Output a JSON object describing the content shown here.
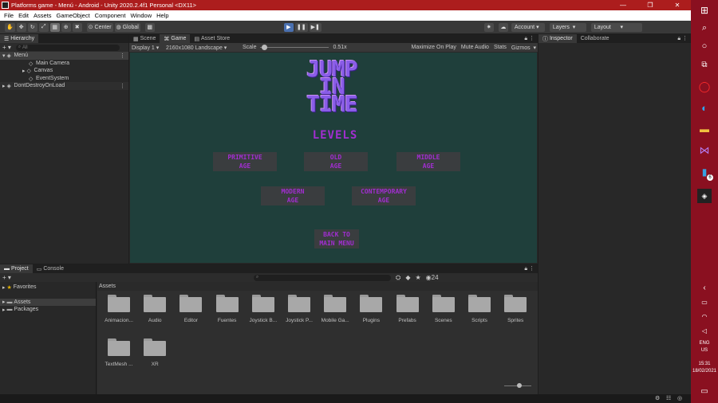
{
  "titlebar": {
    "title": "Platforms game - Menú - Android - Unity 2020.2.4f1 Personal <DX11>",
    "minimize": "—",
    "maximize": "❐",
    "close": "✕"
  },
  "menu": [
    "File",
    "Edit",
    "Assets",
    "GameObject",
    "Component",
    "Window",
    "Help"
  ],
  "toolbar": {
    "pivot": "Center",
    "space": "Global",
    "account": "Account",
    "layers": "Layers",
    "layout": "Layout"
  },
  "hierarchy": {
    "tab": "Hierarchy",
    "search_placeholder": "All",
    "scene": "Menú",
    "items": [
      "Main Camera",
      "Canvas",
      "EventSystem"
    ],
    "dontdestroy": "DontDestroyOnLoad"
  },
  "tabs": {
    "scene": "Scene",
    "game": "Game",
    "assetstore": "Asset Store",
    "inspector": "Inspector",
    "collaborate": "Collaborate",
    "project": "Project",
    "console": "Console"
  },
  "game": {
    "display": "Display 1",
    "resolution": "2160x1080 Landscape",
    "scale_label": "Scale",
    "scale_value": "0.51x",
    "maximize": "Maximize On Play",
    "mute": "Mute Audio",
    "stats": "Stats",
    "gizmos": "Gizmos",
    "logo": [
      "JUMP",
      "IN",
      "TIME"
    ],
    "levels_title": "LEVELS",
    "buttons": [
      [
        "PRIMITIVE",
        "AGE"
      ],
      [
        "OLD",
        "AGE"
      ],
      [
        "MIDDLE",
        "AGE"
      ],
      [
        "MODERN",
        "AGE"
      ],
      [
        "CONTEMPORARY",
        "AGE"
      ],
      [
        "BACK TO",
        "MAIN MENU"
      ]
    ]
  },
  "project": {
    "favorites": "Favorites",
    "assets": "Assets",
    "packages": "Packages",
    "breadcrumb": "Assets",
    "count": "24",
    "folders": [
      "Animacion...",
      "Audio",
      "Editor",
      "Fuentes",
      "Joystick B...",
      "Joystick P...",
      "Mobile Ga...",
      "Plugins",
      "Prefabs",
      "Scenes",
      "Scripts",
      "Sprites",
      "TextMesh ...",
      "XR"
    ]
  },
  "taskbar": {
    "lang": "ENG",
    "region": "US",
    "time": "15:31",
    "date": "18/02/2021",
    "badge": "6"
  },
  "colors": {
    "titlebar": "#ac1d1d",
    "taskbar": "#8a1020",
    "game_bg": "#1f3f3b",
    "game_text": "#a12ed0",
    "play": "#4a70b0"
  }
}
